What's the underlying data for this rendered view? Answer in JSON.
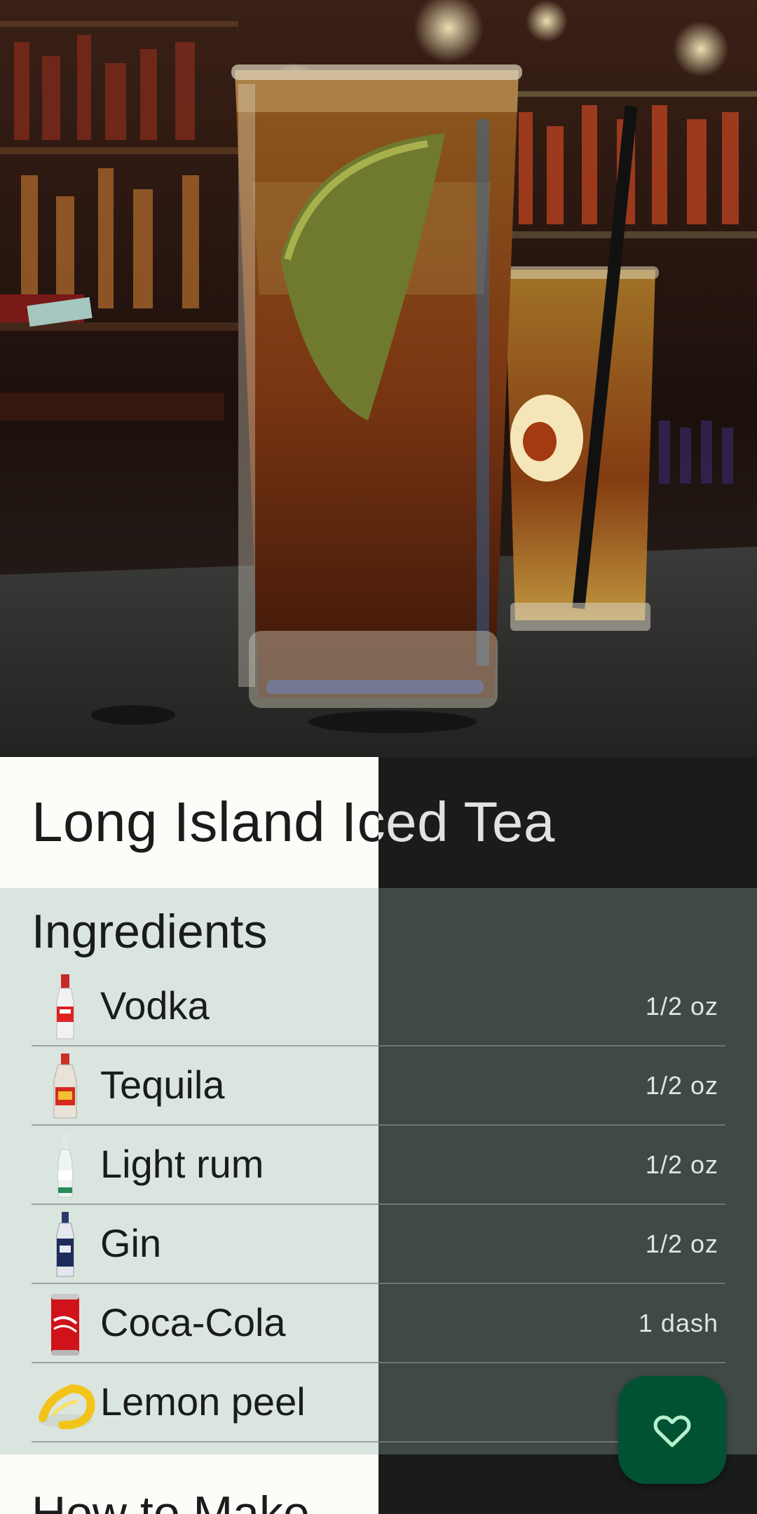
{
  "hero": {
    "image_alt": "cocktail-photo"
  },
  "drink": {
    "title": "Long Island Iced Tea"
  },
  "ingredients": {
    "heading": "Ingredients",
    "items": [
      {
        "name": "Vodka",
        "amount": "1/2 oz",
        "icon": "vodka-bottle-icon"
      },
      {
        "name": "Tequila",
        "amount": "1/2 oz",
        "icon": "tequila-bottle-icon"
      },
      {
        "name": "Light rum",
        "amount": "1/2 oz",
        "icon": "rum-bottle-icon"
      },
      {
        "name": "Gin",
        "amount": "1/2 oz",
        "icon": "gin-bottle-icon"
      },
      {
        "name": "Coca-Cola",
        "amount": "1 dash",
        "icon": "cola-can-icon"
      },
      {
        "name": "Lemon peel",
        "amount": "",
        "icon": "lemon-peel-icon"
      }
    ]
  },
  "how_to_make": {
    "heading": "How to Make"
  },
  "fab": {
    "icon": "heart-outline-icon"
  },
  "colors": {
    "fab": "#005232",
    "light_surface": "#fbfdf9",
    "dark_surface": "#191c1b"
  }
}
